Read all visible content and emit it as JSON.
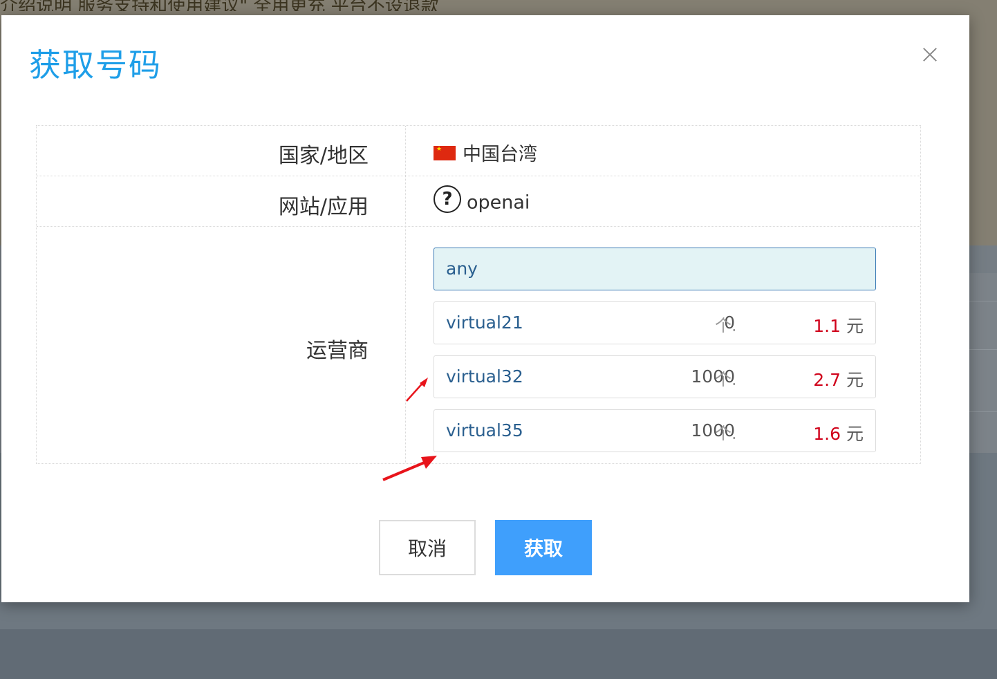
{
  "background": {
    "text": "介绍说明 服务支持和使用建议\" 全用更充 平台不设退款"
  },
  "modal": {
    "title": "获取号码",
    "close_icon": "close-icon",
    "rows": {
      "country": {
        "label": "国家/地区",
        "value": "中国台湾",
        "icon": "flag-icon",
        "flag_color": "#de2910"
      },
      "app": {
        "label": "网站/应用",
        "value": "openai",
        "icon": "question-circle-icon"
      },
      "carrier": {
        "label": "运营商",
        "options": [
          {
            "name": "any",
            "selected": true
          },
          {
            "name": "virtual21",
            "count": "0",
            "unit": "个.",
            "price": "1.1",
            "currency": "元"
          },
          {
            "name": "virtual32",
            "count": "1000",
            "unit": "个.",
            "price": "2.7",
            "currency": "元"
          },
          {
            "name": "virtual35",
            "count": "1000",
            "unit": "个.",
            "price": "1.6",
            "currency": "元"
          }
        ]
      }
    },
    "buttons": {
      "cancel": "取消",
      "confirm": "获取"
    }
  },
  "colors": {
    "title": "#1e9ee8",
    "primary_button": "#3f9ffc",
    "price": "#d0021b",
    "selected_bg": "#e3f3f5",
    "annotation_arrow": "#e8141b"
  }
}
